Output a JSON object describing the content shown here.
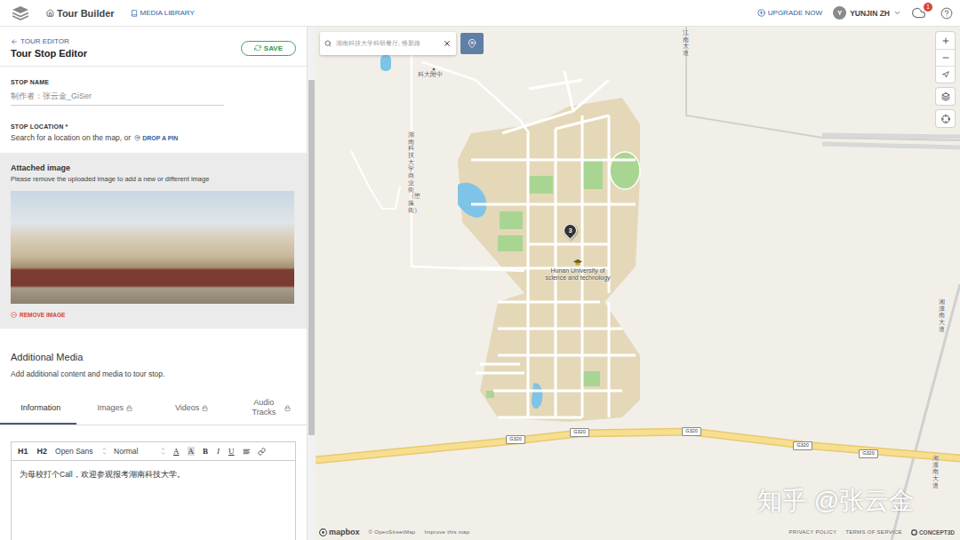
{
  "nav": {
    "brand": "Tour Builder",
    "media_library": "MEDIA LIBRARY",
    "upgrade": "UPGRADE NOW",
    "avatar": "Y",
    "user": "YUNJIN ZH",
    "notification_count": "1"
  },
  "editor": {
    "back": "TOUR EDITOR",
    "title": "Tour Stop Editor",
    "save": "SAVE",
    "stop_name": {
      "label": "STOP NAME",
      "value": "制作者：张云金_GiSer"
    },
    "stop_location": {
      "label": "STOP LOCATION",
      "required": "*",
      "hint": "Search for a location on the map, or",
      "drop_pin": "DROP A PIN"
    },
    "attached_image": {
      "title": "Attached image",
      "hint": "Please remove the uploaded image to add a new or different image",
      "remove": "REMOVE IMAGE"
    },
    "additional_media": {
      "title": "Additional Media",
      "hint": "Add additional content and media to tour stop."
    },
    "tabs": [
      {
        "label": "Information",
        "selected": true,
        "locked": false
      },
      {
        "label": "Images",
        "selected": false,
        "locked": true
      },
      {
        "label": "Videos",
        "selected": false,
        "locked": true
      },
      {
        "label": "Audio Tracks",
        "selected": false,
        "locked": true
      }
    ],
    "toolbar": {
      "headings": [
        "H1",
        "H2"
      ],
      "selects": [
        "Open Sans",
        "Normal"
      ],
      "format": [
        {
          "label": "A",
          "kind": "color"
        },
        {
          "label": "A",
          "kind": "highlight"
        },
        {
          "label": "B",
          "kind": "bold"
        },
        {
          "label": "I",
          "kind": "italic"
        },
        {
          "label": "U",
          "kind": "underline"
        }
      ]
    },
    "content": "为母校打个Call，欢迎参观报考湖南科技大学。"
  },
  "map": {
    "search": {
      "value": "湖南科技大学科研餐厅, 惟新路"
    },
    "place_labels": [
      "科大附中"
    ],
    "campus_label": "Hunan University of science and technology",
    "road_labels": [
      "湖南科技大学商业街（堕落街）",
      "江南大道",
      "湘潭南大道",
      "湘潭南大道"
    ],
    "road_shields": [
      "G320",
      "G320",
      "G320",
      "G320",
      "G320"
    ],
    "pin": {
      "label": "3"
    },
    "attribution": {
      "logo": "mapbox",
      "links": [
        "© OpenStreetMap",
        "Improve this map"
      ]
    },
    "footer": {
      "links": [
        "PRIVACY POLICY",
        "TERMS OF SERVICE"
      ],
      "brand": "CONCEPT3D"
    },
    "watermark": "知乎 @张云金"
  }
}
